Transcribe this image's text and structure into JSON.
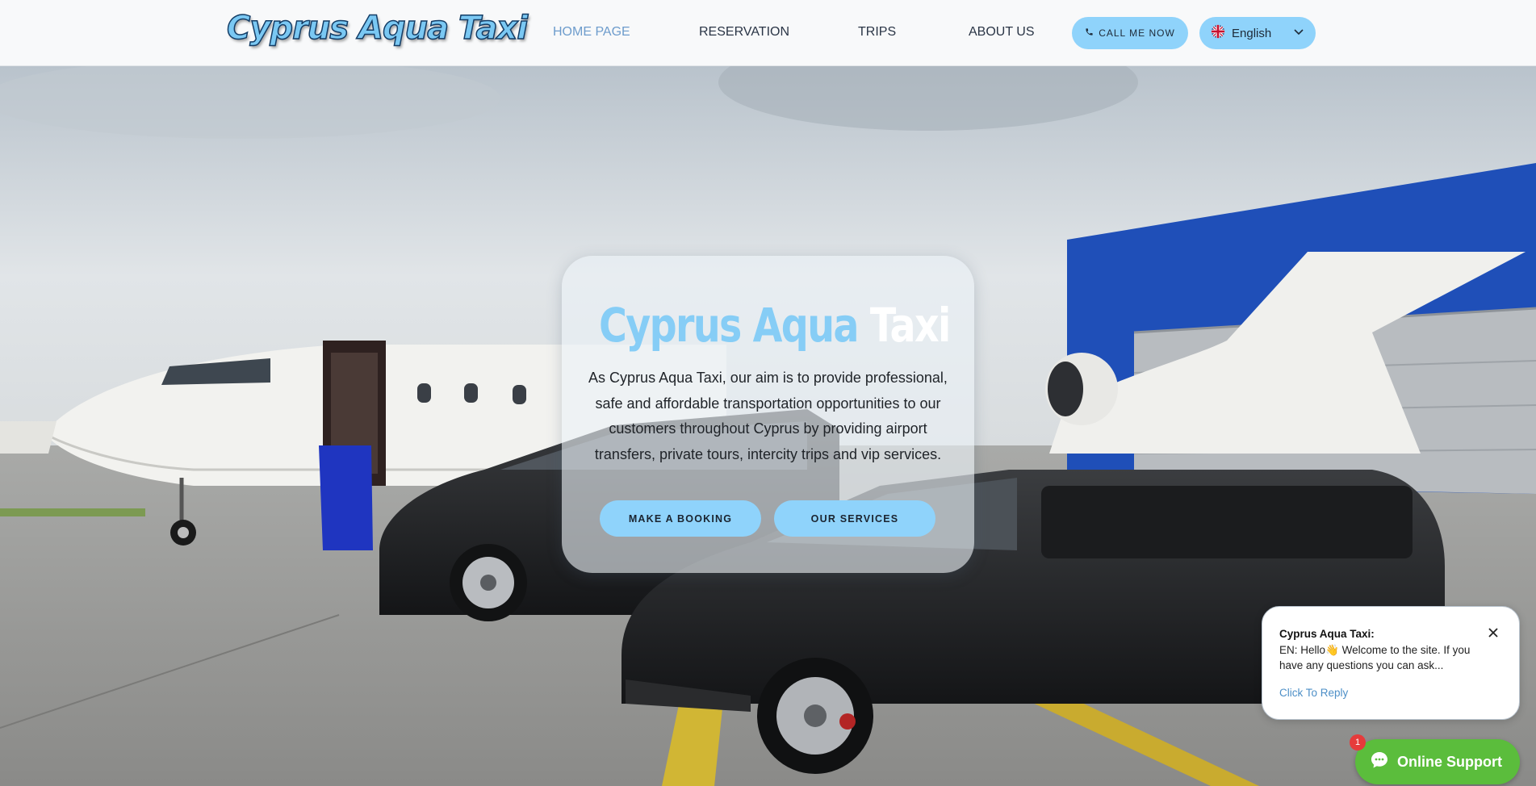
{
  "header": {
    "logo_text": "Cyprus Aqua Taxi",
    "nav": [
      {
        "label": "HOME PAGE",
        "active": true
      },
      {
        "label": "RESERVATION",
        "active": false
      },
      {
        "label": "TRIPS",
        "active": false
      },
      {
        "label": "ABOUT US",
        "active": false
      }
    ],
    "call_button": {
      "label": "CALL ME NOW",
      "icon": "phone-icon"
    },
    "language": {
      "label": "English",
      "icon": "uk-flag-icon",
      "chevron": "chevron-down-icon"
    }
  },
  "hero": {
    "title_part1": "Cyprus Aqua",
    "title_part2": "Taxi",
    "description": "As Cyprus Aqua Taxi, our aim is to provide professional, safe and affordable transportation opportunities to our customers throughout Cyprus by providing airport transfers, private tours, intercity trips and vip services.",
    "booking_button": "MAKE A BOOKING",
    "services_button": "OUR SERVICES"
  },
  "chat": {
    "sender": "Cyprus Aqua Taxi:",
    "message": "EN: Hello👋 Welcome to the site. If you have any questions you can ask...",
    "reply_link": "Click To Reply",
    "support_label": "Online Support",
    "badge_count": "1"
  },
  "colors": {
    "accent": "#8fd3fb",
    "nav_active": "#6d9ccc",
    "support_green": "#5bbd3c",
    "badge_red": "#e63b3b"
  }
}
